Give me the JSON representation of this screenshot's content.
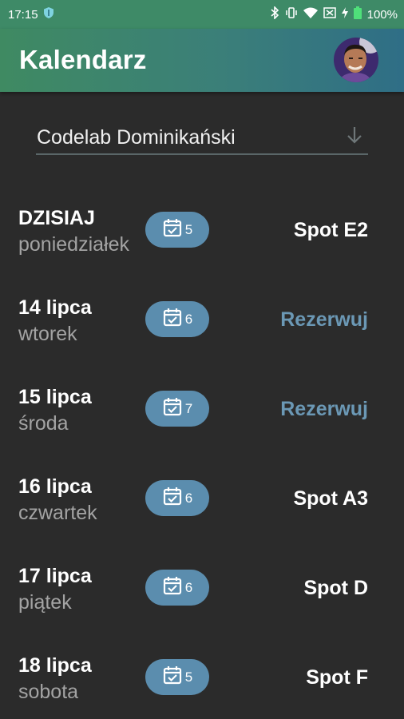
{
  "status_bar": {
    "time": "17:15",
    "battery": "100%"
  },
  "app_bar": {
    "title": "Kalendarz"
  },
  "location_selector": {
    "value": "Codelab Dominikański"
  },
  "days": [
    {
      "date": "DZISIAJ",
      "weekday": "poniedziałek",
      "count": "5",
      "action": "Spot E2",
      "action_type": "spot"
    },
    {
      "date": "14 lipca",
      "weekday": "wtorek",
      "count": "6",
      "action": "Rezerwuj",
      "action_type": "reserve"
    },
    {
      "date": "15 lipca",
      "weekday": "środa",
      "count": "7",
      "action": "Rezerwuj",
      "action_type": "reserve"
    },
    {
      "date": "16 lipca",
      "weekday": "czwartek",
      "count": "6",
      "action": "Spot A3",
      "action_type": "spot"
    },
    {
      "date": "17 lipca",
      "weekday": "piątek",
      "count": "6",
      "action": "Spot D",
      "action_type": "spot"
    },
    {
      "date": "18 lipca",
      "weekday": "sobota",
      "count": "5",
      "action": "Spot F",
      "action_type": "spot"
    }
  ],
  "colors": {
    "background": "#2b2b2b",
    "pill": "#5b8dae",
    "reserve_text": "#6b98b5",
    "app_bar_start": "#3f8a62",
    "app_bar_end": "#2f6e86"
  }
}
